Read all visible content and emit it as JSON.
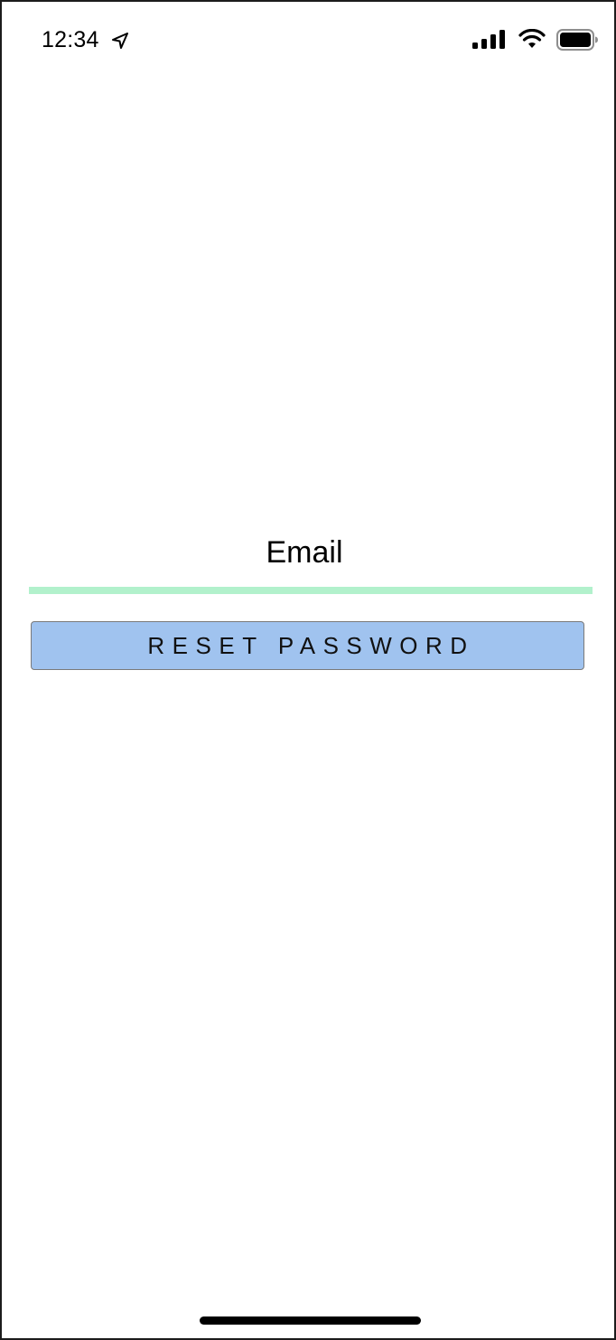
{
  "status_bar": {
    "time": "12:34",
    "icons": [
      "location-arrow-icon",
      "cellular-signal-icon",
      "wifi-icon",
      "battery-icon"
    ]
  },
  "form": {
    "email_label": "Email",
    "email_value": "",
    "reset_button_label": "RESET PASSWORD"
  },
  "colors": {
    "underline_accent": "#b2f1cc",
    "button_background": "#a0c3ef",
    "text": "#000000"
  }
}
